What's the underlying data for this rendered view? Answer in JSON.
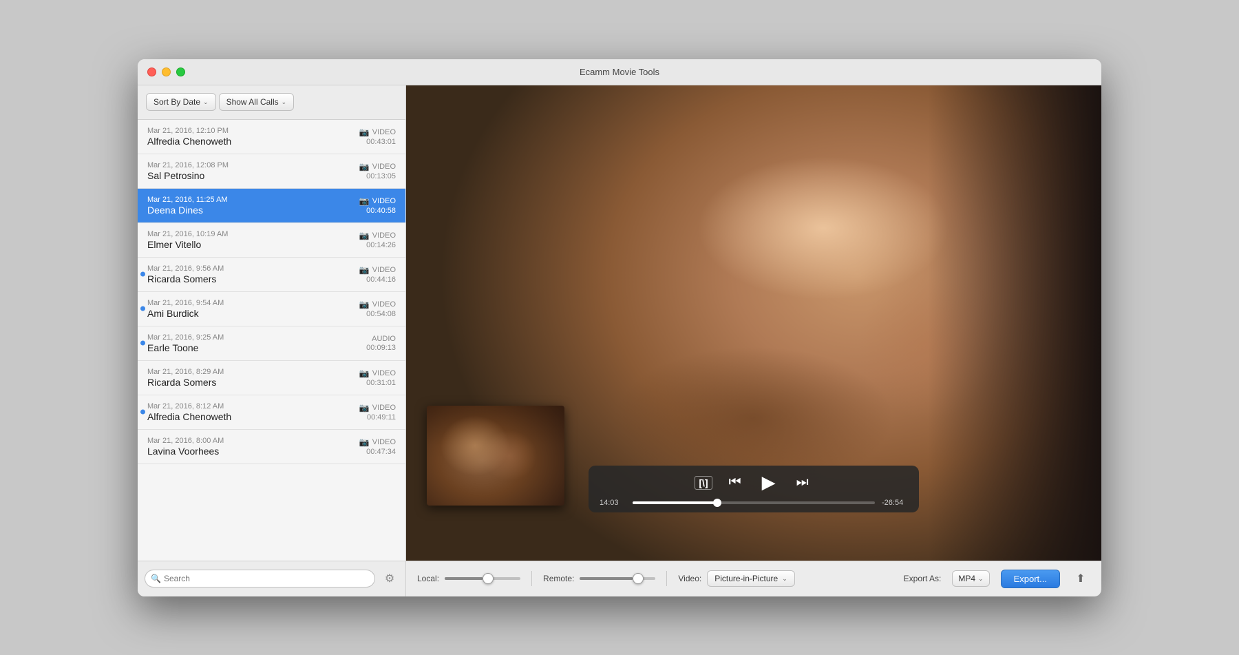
{
  "window": {
    "title": "Ecamm Movie Tools"
  },
  "sidebar": {
    "sort_label": "Sort By Date",
    "show_label": "Show All Calls",
    "search_placeholder": "Search",
    "calls": [
      {
        "date": "Mar 21, 2016, 12:10 PM",
        "name": "Alfredia Chenoweth",
        "type": "VIDEO",
        "duration": "00:43:01",
        "has_dot": false,
        "selected": false
      },
      {
        "date": "Mar 21, 2016, 12:08 PM",
        "name": "Sal Petrosino",
        "type": "VIDEO",
        "duration": "00:13:05",
        "has_dot": false,
        "selected": false
      },
      {
        "date": "Mar 21, 2016, 11:25 AM",
        "name": "Deena Dines",
        "type": "VIDEO",
        "duration": "00:40:58",
        "has_dot": false,
        "selected": true
      },
      {
        "date": "Mar 21, 2016, 10:19 AM",
        "name": "Elmer Vitello",
        "type": "VIDEO",
        "duration": "00:14:26",
        "has_dot": false,
        "selected": false
      },
      {
        "date": "Mar 21, 2016, 9:56 AM",
        "name": "Ricarda Somers",
        "type": "VIDEO",
        "duration": "00:44:16",
        "has_dot": true,
        "selected": false
      },
      {
        "date": "Mar 21, 2016, 9:54 AM",
        "name": "Ami Burdick",
        "type": "VIDEO",
        "duration": "00:54:08",
        "has_dot": true,
        "selected": false
      },
      {
        "date": "Mar 21, 2016, 9:25 AM",
        "name": "Earle Toone",
        "type": "AUDIO",
        "duration": "00:09:13",
        "has_dot": true,
        "selected": false
      },
      {
        "date": "Mar 21, 2016, 8:29 AM",
        "name": "Ricarda Somers",
        "type": "VIDEO",
        "duration": "00:31:01",
        "has_dot": false,
        "selected": false
      },
      {
        "date": "Mar 21, 2016, 8:12 AM",
        "name": "Alfredia Chenoweth",
        "type": "VIDEO",
        "duration": "00:49:11",
        "has_dot": true,
        "selected": false
      },
      {
        "date": "Mar 21, 2016, 8:00 AM",
        "name": "Lavina Voorhees",
        "type": "VIDEO",
        "duration": "00:47:34",
        "has_dot": false,
        "selected": false
      }
    ]
  },
  "player": {
    "time_current": "14:03",
    "time_remaining": "-26:54",
    "progress_pct": 35
  },
  "bottom_bar": {
    "local_label": "Local:",
    "remote_label": "Remote:",
    "video_label": "Video:",
    "video_mode": "Picture-in-Picture",
    "export_as_label": "Export As:",
    "export_format": "MP4",
    "export_btn": "Export..."
  },
  "icons": {
    "sort_chevron": "⌃",
    "show_chevron": "⌃",
    "search": "🔍",
    "gear": "⚙",
    "rewind": "◀◀",
    "play": "▶",
    "fast_forward": "▶▶",
    "bracket": "[\\]",
    "video_cam": "📷",
    "share": "⬆"
  }
}
